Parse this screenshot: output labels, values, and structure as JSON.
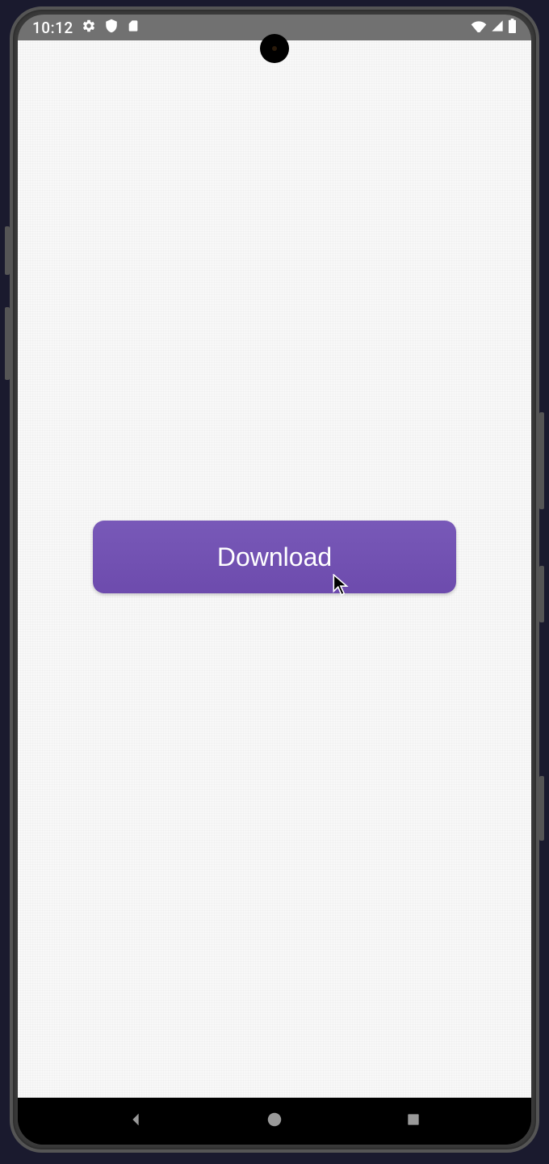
{
  "status_bar": {
    "time": "10:12",
    "icons": {
      "settings": "gear-icon",
      "shield": "shield-icon",
      "sdcard": "sdcard-icon",
      "wifi": "wifi-icon",
      "signal": "signal-icon",
      "battery": "battery-icon"
    }
  },
  "main": {
    "download_button_label": "Download"
  },
  "nav": {
    "back": "back-icon",
    "home": "home-icon",
    "recent": "recent-icon"
  },
  "colors": {
    "button_primary": "#6d4bad",
    "status_bar_bg": "#717171",
    "app_bg": "#f8f8f8"
  }
}
